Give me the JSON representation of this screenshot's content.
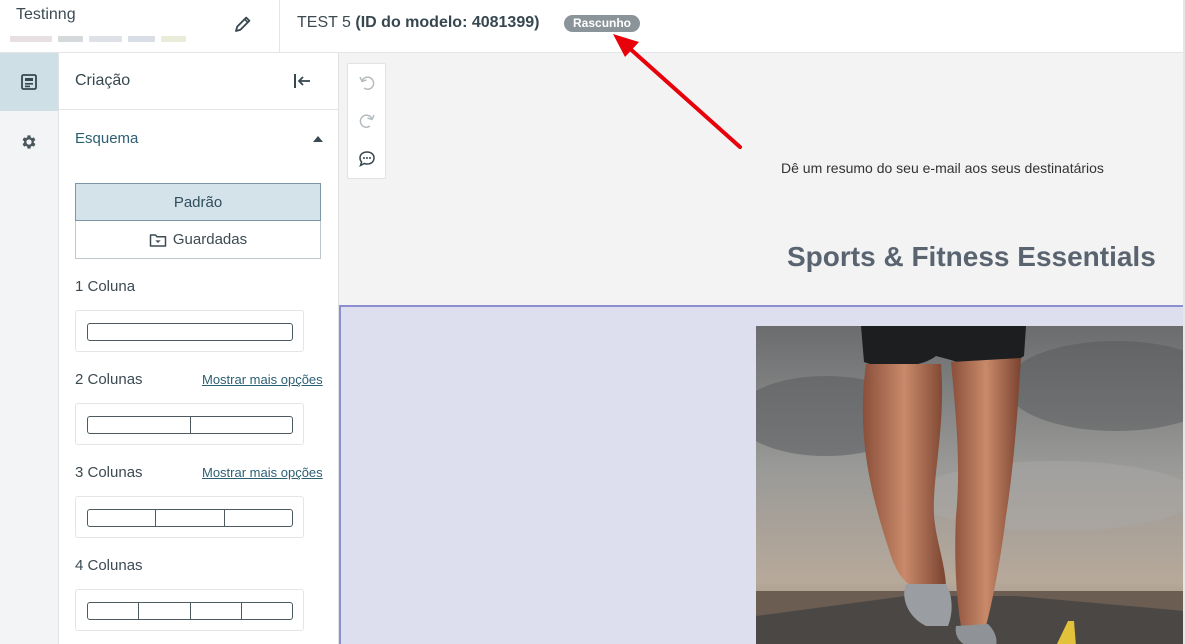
{
  "header": {
    "project_name": "Testinng",
    "template_name": "TEST 5",
    "template_id_text": "(ID do modelo: 4081399)",
    "status_badge": "Rascunho"
  },
  "rail": {
    "items": [
      {
        "icon": "layout-icon",
        "active": true
      },
      {
        "icon": "gear-icon",
        "active": false
      }
    ]
  },
  "panel": {
    "title": "Criação",
    "section_title": "Esquema",
    "tabs": {
      "default_label": "Padrão",
      "saved_label": "Guardadas"
    },
    "layouts": [
      {
        "label": "1 Coluna",
        "columns": 1,
        "more_options": ""
      },
      {
        "label": "2 Colunas",
        "columns": 2,
        "more_options": "Mostrar mais opções"
      },
      {
        "label": "3 Colunas",
        "columns": 3,
        "more_options": "Mostrar mais opções"
      },
      {
        "label": "4 Colunas",
        "columns": 4,
        "more_options": ""
      }
    ]
  },
  "canvas": {
    "preheader": "Dê um resumo do seu e-mail aos seus destinatários",
    "headline": "Sports & Fitness Essentials"
  },
  "colors": {
    "accent": "#2d5f73",
    "badge": "#8a9499",
    "selected_row_border": "#8c8fcf",
    "annotation_arrow": "#e8000b"
  }
}
